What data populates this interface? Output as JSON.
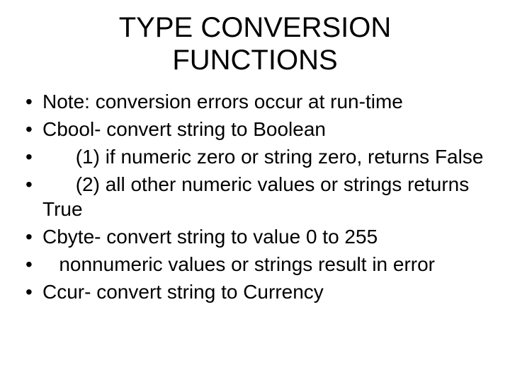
{
  "title_line1": "TYPE CONVERSION",
  "title_line2": "FUNCTIONS",
  "bullets": [
    "Note: conversion errors occur at run-time",
    "Cbool- convert string to Boolean",
    "      (1) if numeric zero or string zero, returns False",
    "      (2) all other numeric values or strings returns       True",
    "Cbyte- convert string to value 0 to 255",
    "   nonnumeric values or strings result in error",
    "Ccur- convert string to Currency"
  ]
}
